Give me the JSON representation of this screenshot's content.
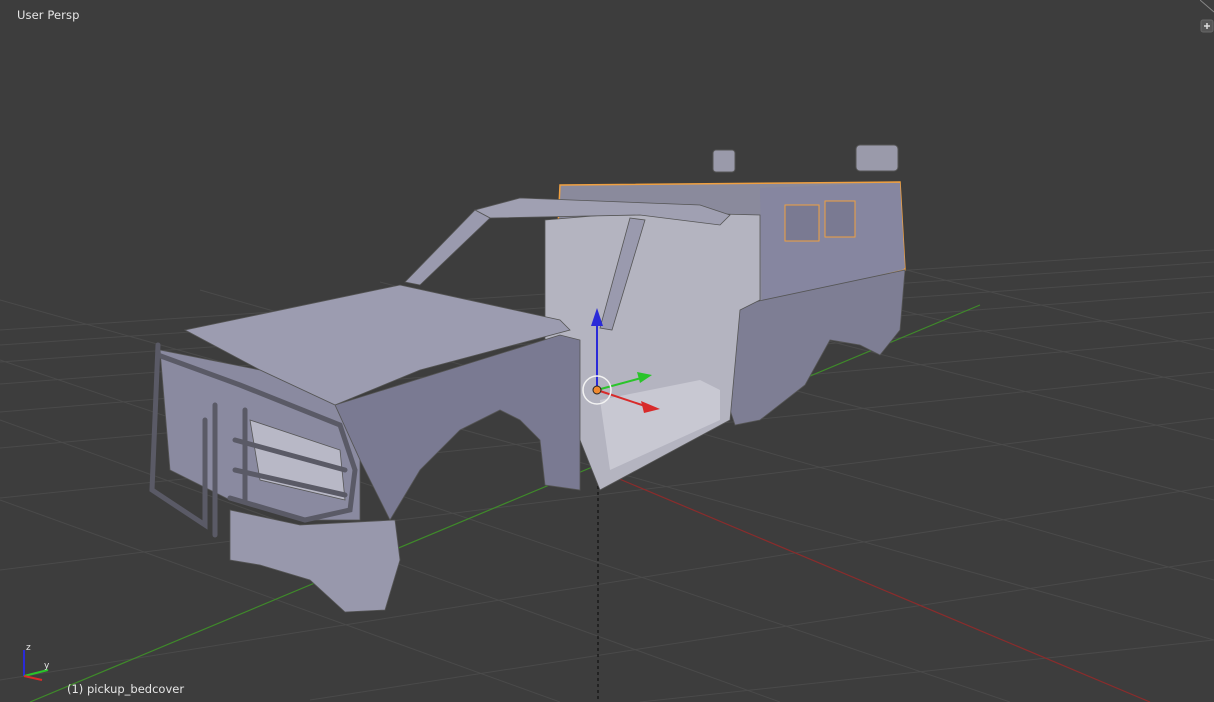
{
  "viewport": {
    "view_name": "User Persp",
    "object_label": "(1) pickup_bedcover",
    "active_object": "pickup_bedcover"
  },
  "axes_widget": {
    "z_label": "z",
    "y_label": "y"
  },
  "colors": {
    "background": "#3d3d3d",
    "grid_line": "#4a4a4a",
    "x_axis": "#8a2c2c",
    "y_axis": "#3f8a2a",
    "selection_outline": "#f0a040",
    "gizmo_z": "#2a2ad8",
    "gizmo_y": "#2ac42a",
    "gizmo_x": "#d82a2a",
    "origin_dot": "#f08a30",
    "label_text": "#e6e6e6"
  },
  "icons": {
    "corner_widget": "plus-icon",
    "transform_gizmo": "translate-manipulator-icon",
    "pivot": "origin-point-icon"
  }
}
